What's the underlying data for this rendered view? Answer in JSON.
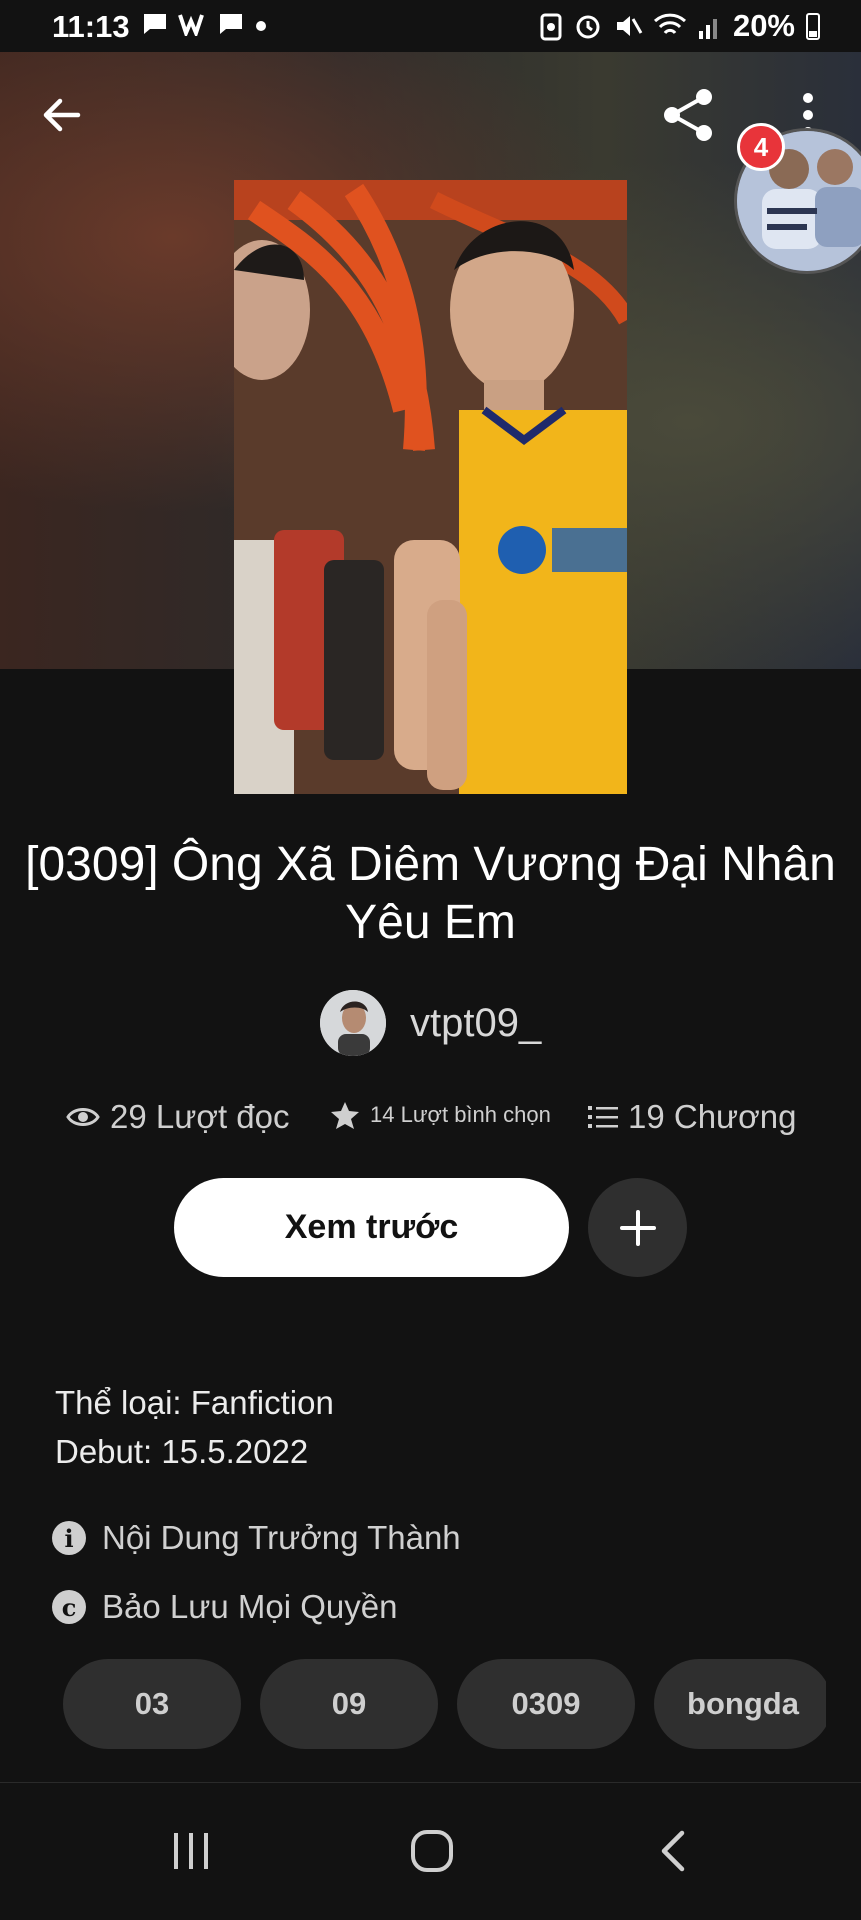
{
  "status_bar": {
    "time": "11:13",
    "battery": "20%",
    "notification_icons": [
      "chat-icon",
      "w-app-icon",
      "chat-icon",
      "dot-icon"
    ],
    "system_icons": [
      "data-saver-icon",
      "alarm-icon",
      "mute-icon",
      "wifi-icon",
      "signal-icon",
      "battery-icon"
    ]
  },
  "header": {
    "back_icon": "arrow-left-icon",
    "share_icon": "share-icon",
    "more_icon": "more-vertical-icon",
    "chat_bubble_badge": "4"
  },
  "story": {
    "title": "[0309] Ông Xã Diêm Vương Đại Nhân Yêu Em",
    "author": "vtpt09_",
    "stats": {
      "reads": "29 Lượt đọc",
      "votes": "14 Lượt bình chọn",
      "parts": "19 Chương"
    },
    "preview_button": "Xem trước",
    "add_icon": "plus-icon",
    "description": [
      "Thể loại: Fanfiction",
      "Debut: 15.5.2022"
    ],
    "mature_label": "Nội Dung Trưởng Thành",
    "copyright_label": "Bảo Lưu Mọi Quyền",
    "tags": [
      "03",
      "09",
      "0309",
      "bongda"
    ]
  },
  "nav_bar": {
    "recents_icon": "recents-icon",
    "home_icon": "home-icon",
    "back_icon": "nav-back-icon"
  },
  "colors": {
    "background": "#121212",
    "badge": "#e8343a",
    "chip": "#2f2f2f",
    "jersey_yellow": "#f2b51a"
  }
}
